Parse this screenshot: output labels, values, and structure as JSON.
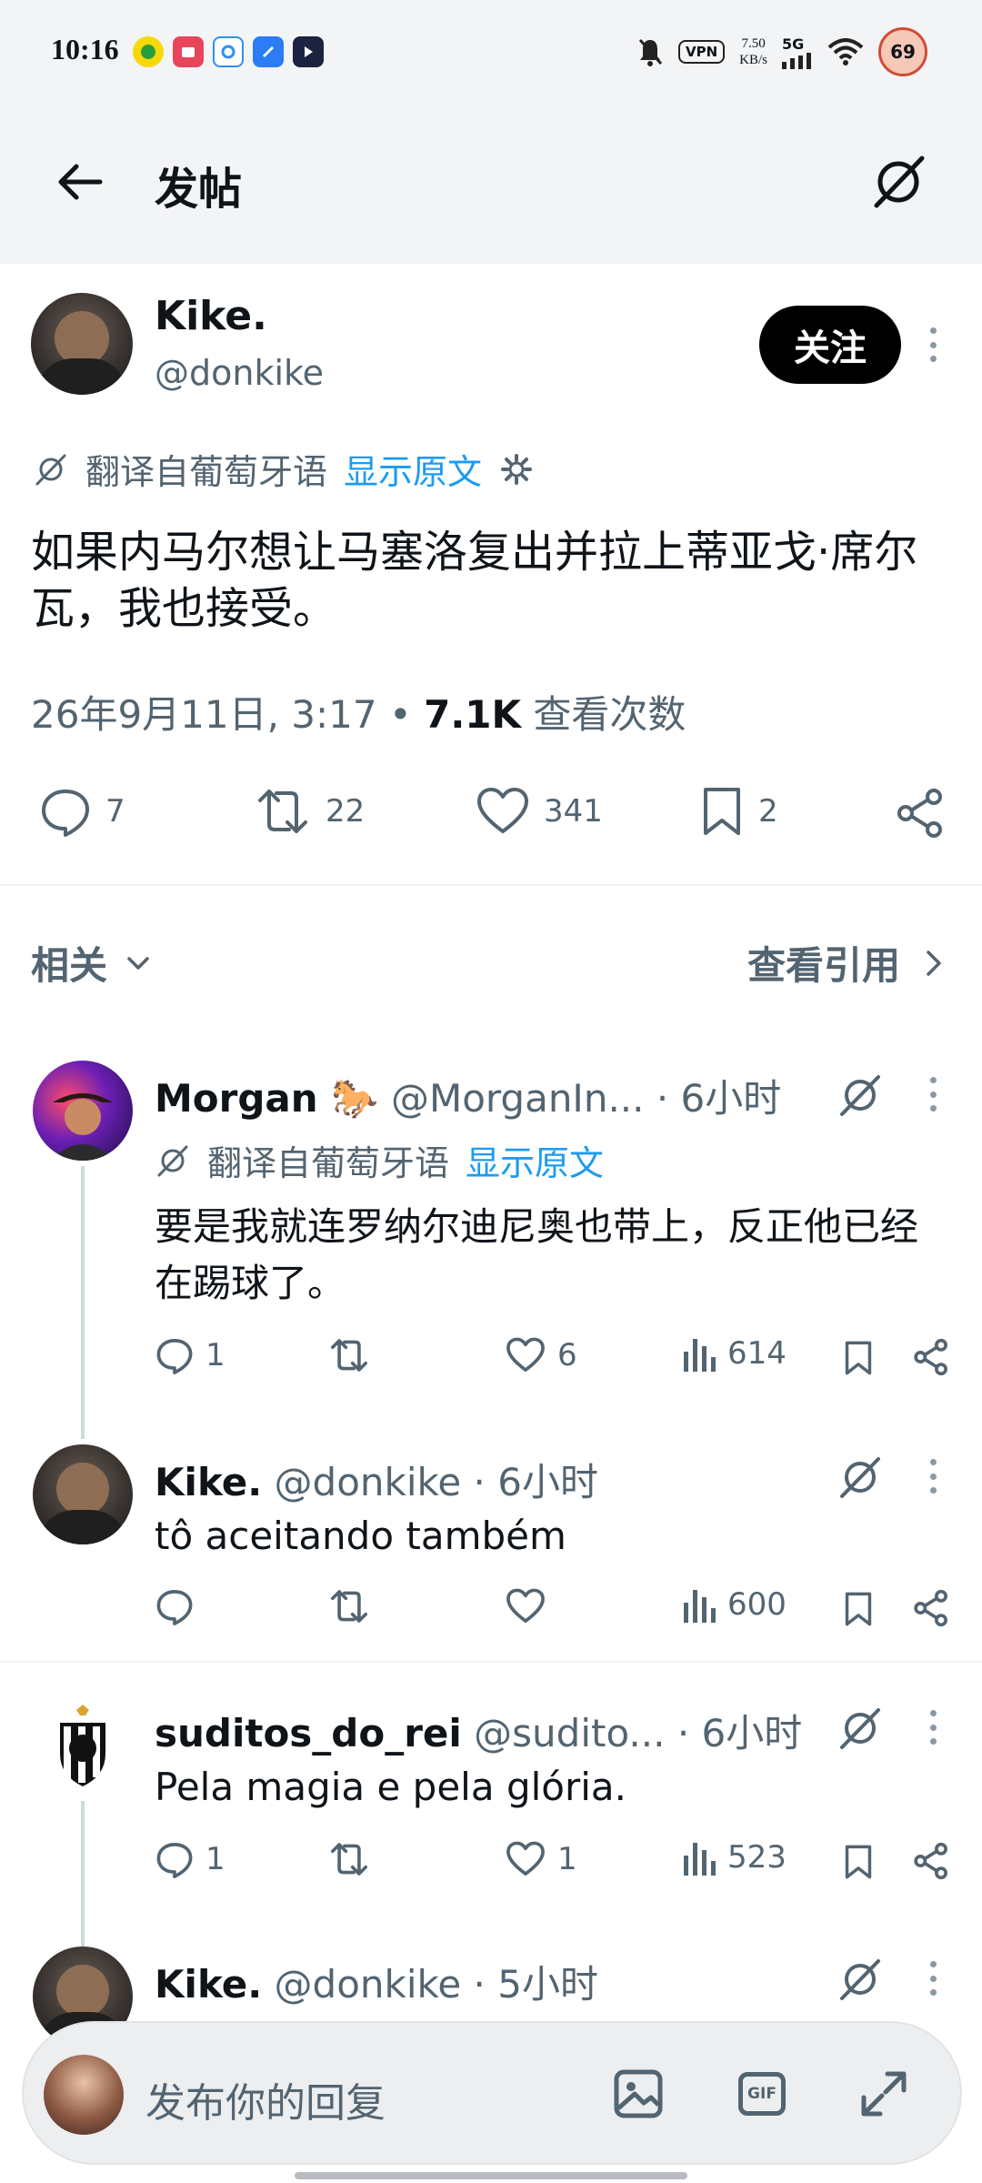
{
  "status_bar": {
    "time": "10:16",
    "vpn": "VPN",
    "speed_value": "7.50",
    "speed_unit": "KB/s",
    "network": "5G",
    "battery": "69"
  },
  "header": {
    "title": "发帖"
  },
  "post": {
    "name": "Kike.",
    "handle": "@donkike",
    "follow_label": "关注",
    "translate_label": "翻译自葡萄牙语",
    "show_original": "显示原文",
    "text": "如果内马尔想让马塞洛复出并拉上蒂亚戈·席尔瓦，我也接受。",
    "date": "26年9月11日, 3:17 •",
    "views_count": "7.1K",
    "views_label": "查看次数",
    "replies": "7",
    "reposts": "22",
    "likes": "341",
    "bookmarks": "2"
  },
  "related": {
    "title": "相关",
    "view_quotes": "查看引用"
  },
  "replies": [
    {
      "name": "Morgan 🐎",
      "handle": "@MorganIn... · 6小时",
      "translate_label": "翻译自葡萄牙语",
      "show_original": "显示原文",
      "text": "要是我就连罗纳尔迪尼奥也带上，反正他已经在踢球了。",
      "replies": "1",
      "reposts": "",
      "likes": "6",
      "views": "614"
    },
    {
      "name": "Kike.",
      "handle": "@donkike · 6小时",
      "text": "tô aceitando também",
      "replies": "",
      "reposts": "",
      "likes": "",
      "views": "600"
    },
    {
      "name": "suditos_do_rei",
      "handle": "@sudito... · 6小时",
      "text": "Pela magia e pela glória.",
      "replies": "1",
      "reposts": "",
      "likes": "1",
      "views": "523"
    },
    {
      "name": "Kike.",
      "handle": "@donkike · 5小时"
    }
  ],
  "composer": {
    "placeholder": "发布你的回复",
    "gif_label": "GIF"
  },
  "colors": {
    "accent": "#1d9bf0",
    "secondary_text": "#536471",
    "follow_bg": "#000000"
  }
}
